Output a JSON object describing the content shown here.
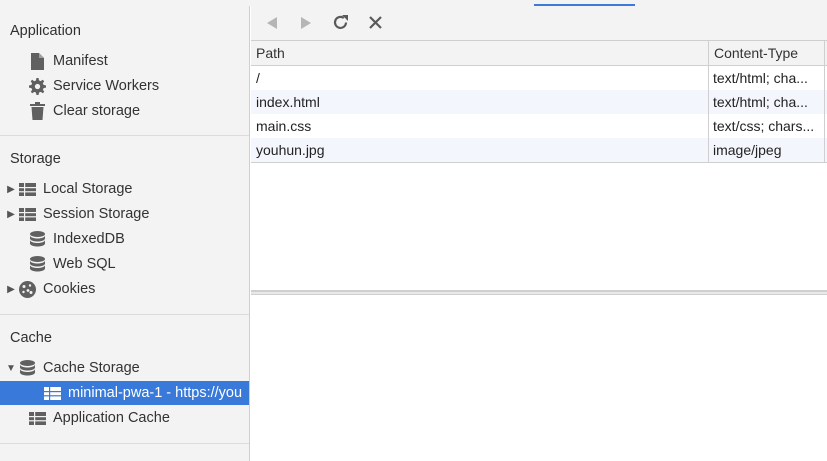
{
  "sidebar": {
    "application": {
      "title": "Application",
      "items": [
        {
          "label": "Manifest",
          "icon": "document-icon"
        },
        {
          "label": "Service Workers",
          "icon": "gear-icon"
        },
        {
          "label": "Clear storage",
          "icon": "trash-icon"
        }
      ]
    },
    "storage": {
      "title": "Storage",
      "items": [
        {
          "label": "Local Storage",
          "icon": "table-icon",
          "expandable": true
        },
        {
          "label": "Session Storage",
          "icon": "table-icon",
          "expandable": true
        },
        {
          "label": "IndexedDB",
          "icon": "database-icon"
        },
        {
          "label": "Web SQL",
          "icon": "database-icon"
        },
        {
          "label": "Cookies",
          "icon": "cookie-icon",
          "expandable": true
        }
      ]
    },
    "cache": {
      "title": "Cache",
      "items": [
        {
          "label": "Cache Storage",
          "icon": "database-icon",
          "expanded": true
        },
        {
          "label": "minimal-pwa-1 - https://you",
          "icon": "table-icon",
          "selected": true
        },
        {
          "label": "Application Cache",
          "icon": "table-icon"
        }
      ]
    }
  },
  "toolbar": {
    "back": "back-icon",
    "forward": "forward-icon",
    "refresh": "refresh-icon",
    "delete": "close-icon"
  },
  "grid": {
    "columns": [
      "Path",
      "Content-Type"
    ],
    "rows": [
      {
        "path": "/",
        "type": "text/html; cha..."
      },
      {
        "path": "index.html",
        "type": "text/html; cha..."
      },
      {
        "path": "main.css",
        "type": "text/css; chars..."
      },
      {
        "path": "youhun.jpg",
        "type": "image/jpeg"
      }
    ]
  },
  "colors": {
    "selection": "#3879d9",
    "accent": "#3c7ad9",
    "panel_bg": "#f3f3f3"
  }
}
